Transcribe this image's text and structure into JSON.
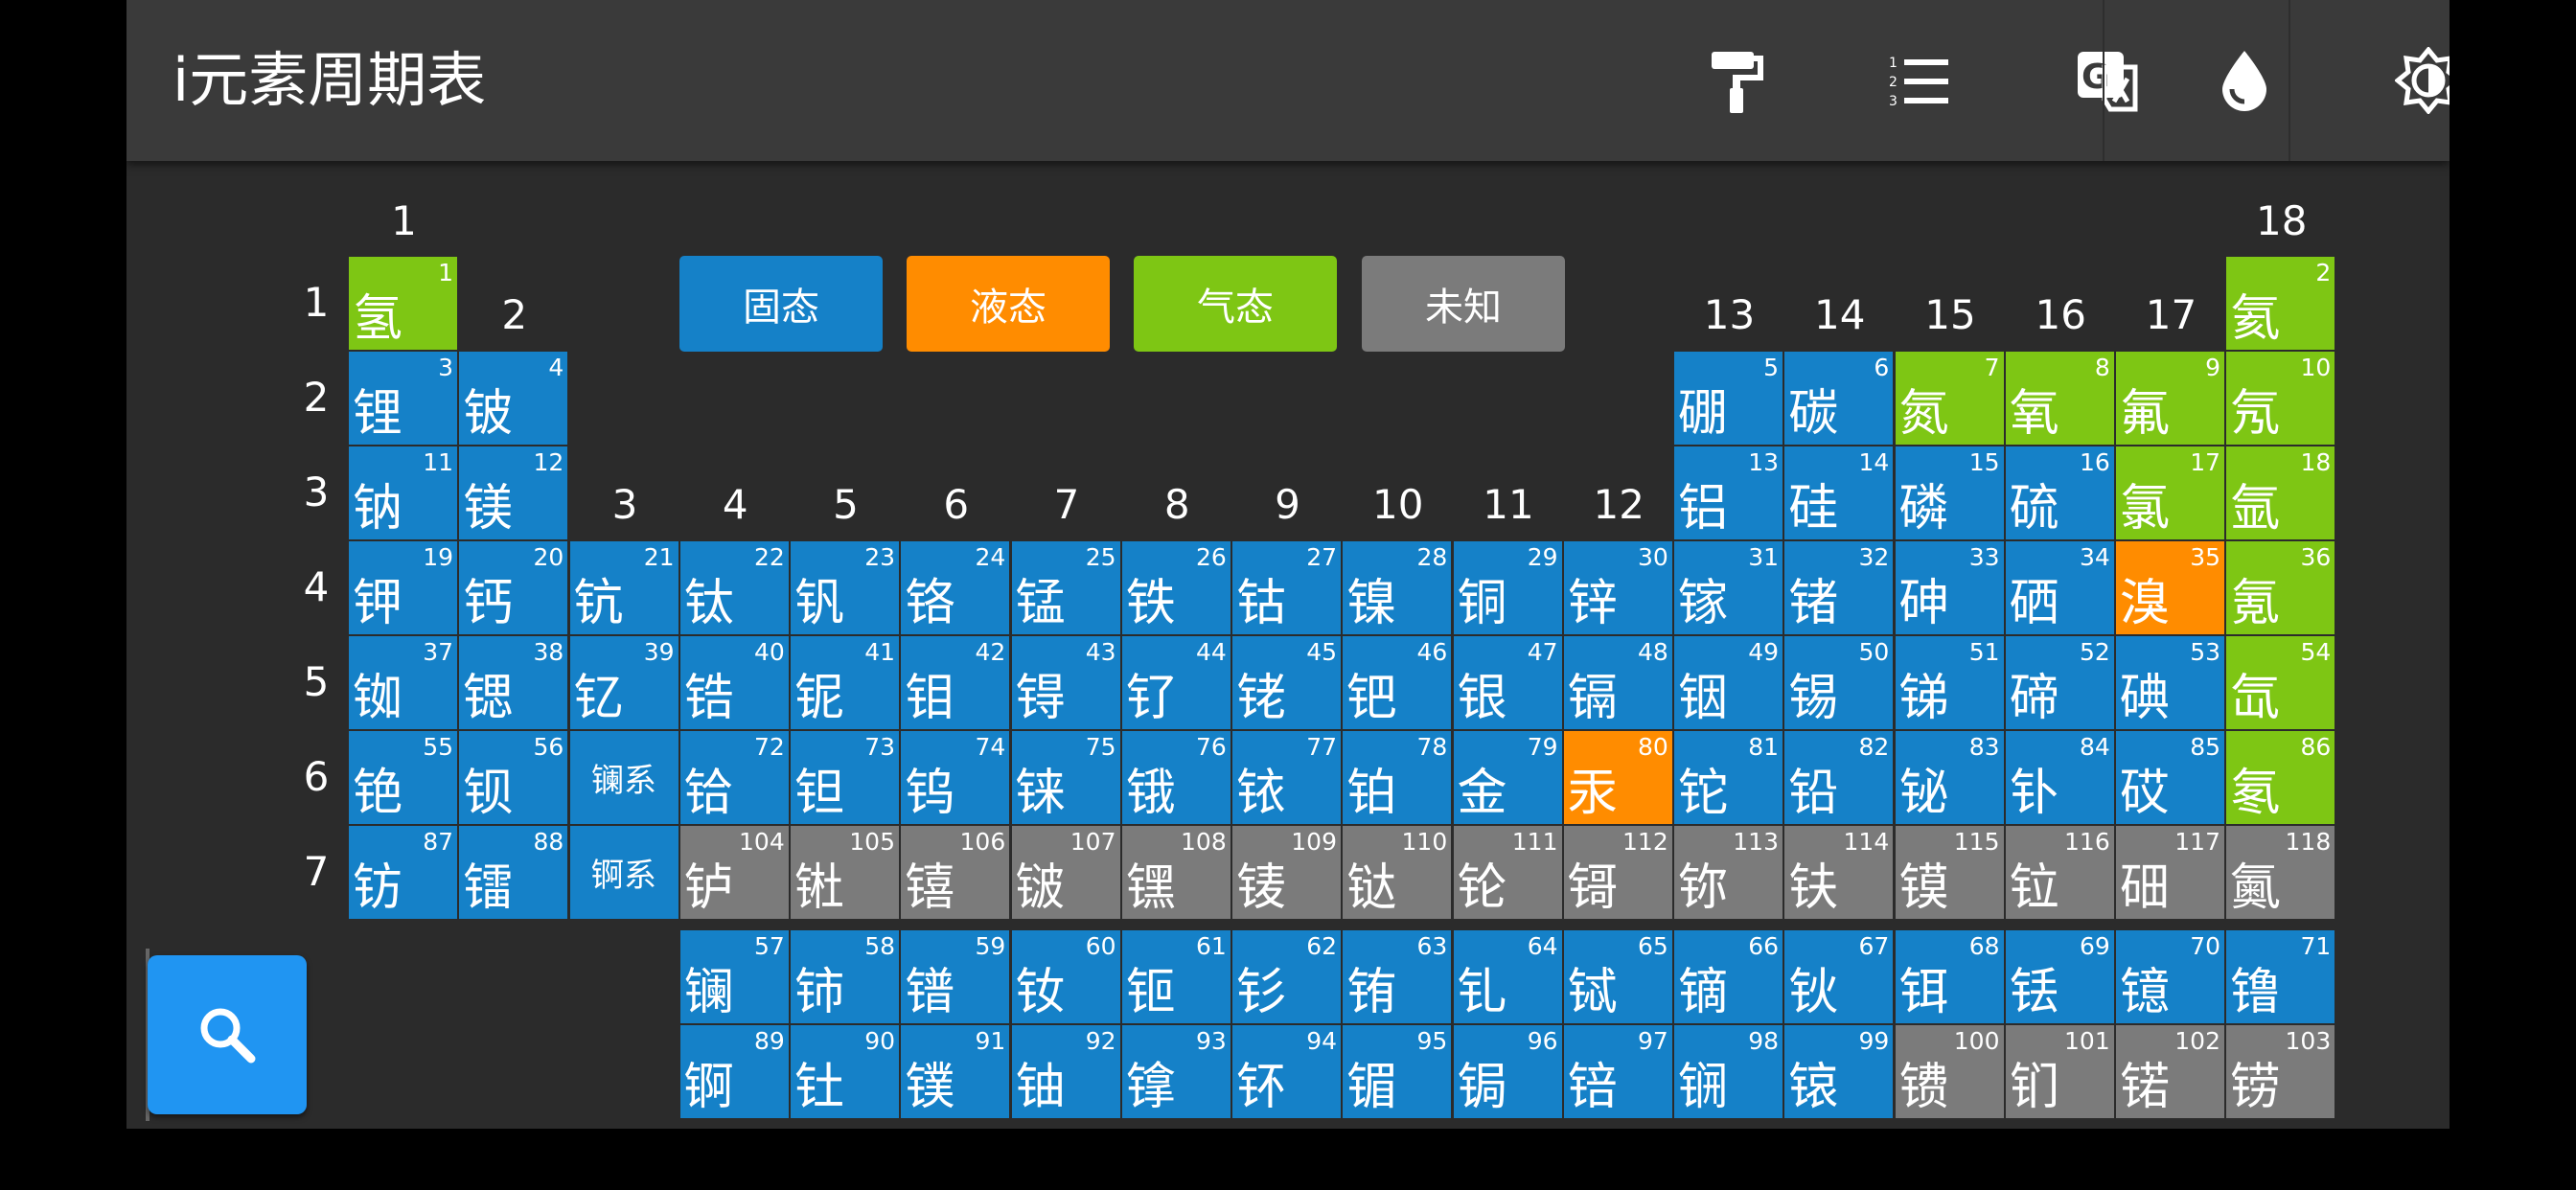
{
  "app": {
    "title": "i元素周期表"
  },
  "toolbar": [
    {
      "name": "paint-roller-icon"
    },
    {
      "name": "numbered-list-icon"
    },
    {
      "name": "translate-icon"
    },
    {
      "name": "water-drop-icon"
    },
    {
      "name": "brightness-icon"
    }
  ],
  "legend": [
    {
      "label": "固态",
      "color": "#1581c8"
    },
    {
      "label": "液态",
      "color": "#ff8c00"
    },
    {
      "label": "气态",
      "color": "#7ec614"
    },
    {
      "label": "未知",
      "color": "#7b7b7b"
    }
  ],
  "groups": [
    "1",
    "2",
    "3",
    "4",
    "5",
    "6",
    "7",
    "8",
    "9",
    "10",
    "11",
    "12",
    "13",
    "14",
    "15",
    "16",
    "17",
    "18"
  ],
  "periods": [
    "1",
    "2",
    "3",
    "4",
    "5",
    "6",
    "7"
  ],
  "series_labels": {
    "lanthanide": "镧系",
    "actinide": "锕系"
  },
  "search": {
    "icon": "search-icon"
  },
  "elements": [
    {
      "z": 1,
      "s": "氢",
      "p": 1,
      "g": 1,
      "st": "gas"
    },
    {
      "z": 2,
      "s": "氦",
      "p": 1,
      "g": 18,
      "st": "gas"
    },
    {
      "z": 3,
      "s": "锂",
      "p": 2,
      "g": 1,
      "st": "solid"
    },
    {
      "z": 4,
      "s": "铍",
      "p": 2,
      "g": 2,
      "st": "solid"
    },
    {
      "z": 5,
      "s": "硼",
      "p": 2,
      "g": 13,
      "st": "solid"
    },
    {
      "z": 6,
      "s": "碳",
      "p": 2,
      "g": 14,
      "st": "solid"
    },
    {
      "z": 7,
      "s": "氮",
      "p": 2,
      "g": 15,
      "st": "gas"
    },
    {
      "z": 8,
      "s": "氧",
      "p": 2,
      "g": 16,
      "st": "gas"
    },
    {
      "z": 9,
      "s": "氟",
      "p": 2,
      "g": 17,
      "st": "gas"
    },
    {
      "z": 10,
      "s": "氖",
      "p": 2,
      "g": 18,
      "st": "gas"
    },
    {
      "z": 11,
      "s": "钠",
      "p": 3,
      "g": 1,
      "st": "solid"
    },
    {
      "z": 12,
      "s": "镁",
      "p": 3,
      "g": 2,
      "st": "solid"
    },
    {
      "z": 13,
      "s": "铝",
      "p": 3,
      "g": 13,
      "st": "solid"
    },
    {
      "z": 14,
      "s": "硅",
      "p": 3,
      "g": 14,
      "st": "solid"
    },
    {
      "z": 15,
      "s": "磷",
      "p": 3,
      "g": 15,
      "st": "solid"
    },
    {
      "z": 16,
      "s": "硫",
      "p": 3,
      "g": 16,
      "st": "solid"
    },
    {
      "z": 17,
      "s": "氯",
      "p": 3,
      "g": 17,
      "st": "gas"
    },
    {
      "z": 18,
      "s": "氩",
      "p": 3,
      "g": 18,
      "st": "gas"
    },
    {
      "z": 19,
      "s": "钾",
      "p": 4,
      "g": 1,
      "st": "solid"
    },
    {
      "z": 20,
      "s": "钙",
      "p": 4,
      "g": 2,
      "st": "solid"
    },
    {
      "z": 21,
      "s": "钪",
      "p": 4,
      "g": 3,
      "st": "solid"
    },
    {
      "z": 22,
      "s": "钛",
      "p": 4,
      "g": 4,
      "st": "solid"
    },
    {
      "z": 23,
      "s": "钒",
      "p": 4,
      "g": 5,
      "st": "solid"
    },
    {
      "z": 24,
      "s": "铬",
      "p": 4,
      "g": 6,
      "st": "solid"
    },
    {
      "z": 25,
      "s": "锰",
      "p": 4,
      "g": 7,
      "st": "solid"
    },
    {
      "z": 26,
      "s": "铁",
      "p": 4,
      "g": 8,
      "st": "solid"
    },
    {
      "z": 27,
      "s": "钴",
      "p": 4,
      "g": 9,
      "st": "solid"
    },
    {
      "z": 28,
      "s": "镍",
      "p": 4,
      "g": 10,
      "st": "solid"
    },
    {
      "z": 29,
      "s": "铜",
      "p": 4,
      "g": 11,
      "st": "solid"
    },
    {
      "z": 30,
      "s": "锌",
      "p": 4,
      "g": 12,
      "st": "solid"
    },
    {
      "z": 31,
      "s": "镓",
      "p": 4,
      "g": 13,
      "st": "solid"
    },
    {
      "z": 32,
      "s": "锗",
      "p": 4,
      "g": 14,
      "st": "solid"
    },
    {
      "z": 33,
      "s": "砷",
      "p": 4,
      "g": 15,
      "st": "solid"
    },
    {
      "z": 34,
      "s": "硒",
      "p": 4,
      "g": 16,
      "st": "solid"
    },
    {
      "z": 35,
      "s": "溴",
      "p": 4,
      "g": 17,
      "st": "liquid"
    },
    {
      "z": 36,
      "s": "氪",
      "p": 4,
      "g": 18,
      "st": "gas"
    },
    {
      "z": 37,
      "s": "铷",
      "p": 5,
      "g": 1,
      "st": "solid"
    },
    {
      "z": 38,
      "s": "锶",
      "p": 5,
      "g": 2,
      "st": "solid"
    },
    {
      "z": 39,
      "s": "钇",
      "p": 5,
      "g": 3,
      "st": "solid"
    },
    {
      "z": 40,
      "s": "锆",
      "p": 5,
      "g": 4,
      "st": "solid"
    },
    {
      "z": 41,
      "s": "铌",
      "p": 5,
      "g": 5,
      "st": "solid"
    },
    {
      "z": 42,
      "s": "钼",
      "p": 5,
      "g": 6,
      "st": "solid"
    },
    {
      "z": 43,
      "s": "锝",
      "p": 5,
      "g": 7,
      "st": "solid"
    },
    {
      "z": 44,
      "s": "钌",
      "p": 5,
      "g": 8,
      "st": "solid"
    },
    {
      "z": 45,
      "s": "铑",
      "p": 5,
      "g": 9,
      "st": "solid"
    },
    {
      "z": 46,
      "s": "钯",
      "p": 5,
      "g": 10,
      "st": "solid"
    },
    {
      "z": 47,
      "s": "银",
      "p": 5,
      "g": 11,
      "st": "solid"
    },
    {
      "z": 48,
      "s": "镉",
      "p": 5,
      "g": 12,
      "st": "solid"
    },
    {
      "z": 49,
      "s": "铟",
      "p": 5,
      "g": 13,
      "st": "solid"
    },
    {
      "z": 50,
      "s": "锡",
      "p": 5,
      "g": 14,
      "st": "solid"
    },
    {
      "z": 51,
      "s": "锑",
      "p": 5,
      "g": 15,
      "st": "solid"
    },
    {
      "z": 52,
      "s": "碲",
      "p": 5,
      "g": 16,
      "st": "solid"
    },
    {
      "z": 53,
      "s": "碘",
      "p": 5,
      "g": 17,
      "st": "solid"
    },
    {
      "z": 54,
      "s": "氙",
      "p": 5,
      "g": 18,
      "st": "gas"
    },
    {
      "z": 55,
      "s": "铯",
      "p": 6,
      "g": 1,
      "st": "solid"
    },
    {
      "z": 56,
      "s": "钡",
      "p": 6,
      "g": 2,
      "st": "solid"
    },
    {
      "z": 72,
      "s": "铪",
      "p": 6,
      "g": 4,
      "st": "solid"
    },
    {
      "z": 73,
      "s": "钽",
      "p": 6,
      "g": 5,
      "st": "solid"
    },
    {
      "z": 74,
      "s": "钨",
      "p": 6,
      "g": 6,
      "st": "solid"
    },
    {
      "z": 75,
      "s": "铼",
      "p": 6,
      "g": 7,
      "st": "solid"
    },
    {
      "z": 76,
      "s": "锇",
      "p": 6,
      "g": 8,
      "st": "solid"
    },
    {
      "z": 77,
      "s": "铱",
      "p": 6,
      "g": 9,
      "st": "solid"
    },
    {
      "z": 78,
      "s": "铂",
      "p": 6,
      "g": 10,
      "st": "solid"
    },
    {
      "z": 79,
      "s": "金",
      "p": 6,
      "g": 11,
      "st": "solid"
    },
    {
      "z": 80,
      "s": "汞",
      "p": 6,
      "g": 12,
      "st": "liquid"
    },
    {
      "z": 81,
      "s": "铊",
      "p": 6,
      "g": 13,
      "st": "solid"
    },
    {
      "z": 82,
      "s": "铅",
      "p": 6,
      "g": 14,
      "st": "solid"
    },
    {
      "z": 83,
      "s": "铋",
      "p": 6,
      "g": 15,
      "st": "solid"
    },
    {
      "z": 84,
      "s": "钋",
      "p": 6,
      "g": 16,
      "st": "solid"
    },
    {
      "z": 85,
      "s": "砹",
      "p": 6,
      "g": 17,
      "st": "solid"
    },
    {
      "z": 86,
      "s": "氡",
      "p": 6,
      "g": 18,
      "st": "gas"
    },
    {
      "z": 87,
      "s": "钫",
      "p": 7,
      "g": 1,
      "st": "solid"
    },
    {
      "z": 88,
      "s": "镭",
      "p": 7,
      "g": 2,
      "st": "solid"
    },
    {
      "z": 104,
      "s": "𬬻",
      "p": 7,
      "g": 4,
      "st": "unknown"
    },
    {
      "z": 105,
      "s": "𬭊",
      "p": 7,
      "g": 5,
      "st": "unknown"
    },
    {
      "z": 106,
      "s": "𬭳",
      "p": 7,
      "g": 6,
      "st": "unknown"
    },
    {
      "z": 107,
      "s": "𬭛",
      "p": 7,
      "g": 7,
      "st": "unknown"
    },
    {
      "z": 108,
      "s": "𬭶",
      "p": 7,
      "g": 8,
      "st": "unknown"
    },
    {
      "z": 109,
      "s": "鿏",
      "p": 7,
      "g": 9,
      "st": "unknown"
    },
    {
      "z": 110,
      "s": "𫟼",
      "p": 7,
      "g": 10,
      "st": "unknown"
    },
    {
      "z": 111,
      "s": "𬬭",
      "p": 7,
      "g": 11,
      "st": "unknown"
    },
    {
      "z": 112,
      "s": "鿔",
      "p": 7,
      "g": 12,
      "st": "unknown"
    },
    {
      "z": 113,
      "s": "鿭",
      "p": 7,
      "g": 13,
      "st": "unknown"
    },
    {
      "z": 114,
      "s": "𫓧",
      "p": 7,
      "g": 14,
      "st": "unknown"
    },
    {
      "z": 115,
      "s": "镆",
      "p": 7,
      "g": 15,
      "st": "unknown"
    },
    {
      "z": 116,
      "s": "𫟷",
      "p": 7,
      "g": 16,
      "st": "unknown"
    },
    {
      "z": 117,
      "s": "鿬",
      "p": 7,
      "g": 17,
      "st": "unknown"
    },
    {
      "z": 118,
      "s": "鿫",
      "p": 7,
      "g": 18,
      "st": "unknown"
    },
    {
      "z": 57,
      "s": "镧",
      "p": 9,
      "g": 4,
      "st": "solid"
    },
    {
      "z": 58,
      "s": "铈",
      "p": 9,
      "g": 5,
      "st": "solid"
    },
    {
      "z": 59,
      "s": "镨",
      "p": 9,
      "g": 6,
      "st": "solid"
    },
    {
      "z": 60,
      "s": "钕",
      "p": 9,
      "g": 7,
      "st": "solid"
    },
    {
      "z": 61,
      "s": "钷",
      "p": 9,
      "g": 8,
      "st": "solid"
    },
    {
      "z": 62,
      "s": "钐",
      "p": 9,
      "g": 9,
      "st": "solid"
    },
    {
      "z": 63,
      "s": "铕",
      "p": 9,
      "g": 10,
      "st": "solid"
    },
    {
      "z": 64,
      "s": "钆",
      "p": 9,
      "g": 11,
      "st": "solid"
    },
    {
      "z": 65,
      "s": "铽",
      "p": 9,
      "g": 12,
      "st": "solid"
    },
    {
      "z": 66,
      "s": "镝",
      "p": 9,
      "g": 13,
      "st": "solid"
    },
    {
      "z": 67,
      "s": "钬",
      "p": 9,
      "g": 14,
      "st": "solid"
    },
    {
      "z": 68,
      "s": "铒",
      "p": 9,
      "g": 15,
      "st": "solid"
    },
    {
      "z": 69,
      "s": "铥",
      "p": 9,
      "g": 16,
      "st": "solid"
    },
    {
      "z": 70,
      "s": "镱",
      "p": 9,
      "g": 17,
      "st": "solid"
    },
    {
      "z": 71,
      "s": "镥",
      "p": 9,
      "g": 18,
      "st": "solid"
    },
    {
      "z": 89,
      "s": "锕",
      "p": 10,
      "g": 4,
      "st": "solid"
    },
    {
      "z": 90,
      "s": "钍",
      "p": 10,
      "g": 5,
      "st": "solid"
    },
    {
      "z": 91,
      "s": "镤",
      "p": 10,
      "g": 6,
      "st": "solid"
    },
    {
      "z": 92,
      "s": "铀",
      "p": 10,
      "g": 7,
      "st": "solid"
    },
    {
      "z": 93,
      "s": "镎",
      "p": 10,
      "g": 8,
      "st": "solid"
    },
    {
      "z": 94,
      "s": "钚",
      "p": 10,
      "g": 9,
      "st": "solid"
    },
    {
      "z": 95,
      "s": "镅",
      "p": 10,
      "g": 10,
      "st": "solid"
    },
    {
      "z": 96,
      "s": "锔",
      "p": 10,
      "g": 11,
      "st": "solid"
    },
    {
      "z": 97,
      "s": "锫",
      "p": 10,
      "g": 12,
      "st": "solid"
    },
    {
      "z": 98,
      "s": "锎",
      "p": 10,
      "g": 13,
      "st": "solid"
    },
    {
      "z": 99,
      "s": "锿",
      "p": 10,
      "g": 14,
      "st": "solid"
    },
    {
      "z": 100,
      "s": "镄",
      "p": 10,
      "g": 15,
      "st": "unknown"
    },
    {
      "z": 101,
      "s": "钔",
      "p": 10,
      "g": 16,
      "st": "unknown"
    },
    {
      "z": 102,
      "s": "锘",
      "p": 10,
      "g": 17,
      "st": "unknown"
    },
    {
      "z": 103,
      "s": "铹",
      "p": 10,
      "g": 18,
      "st": "unknown"
    }
  ]
}
